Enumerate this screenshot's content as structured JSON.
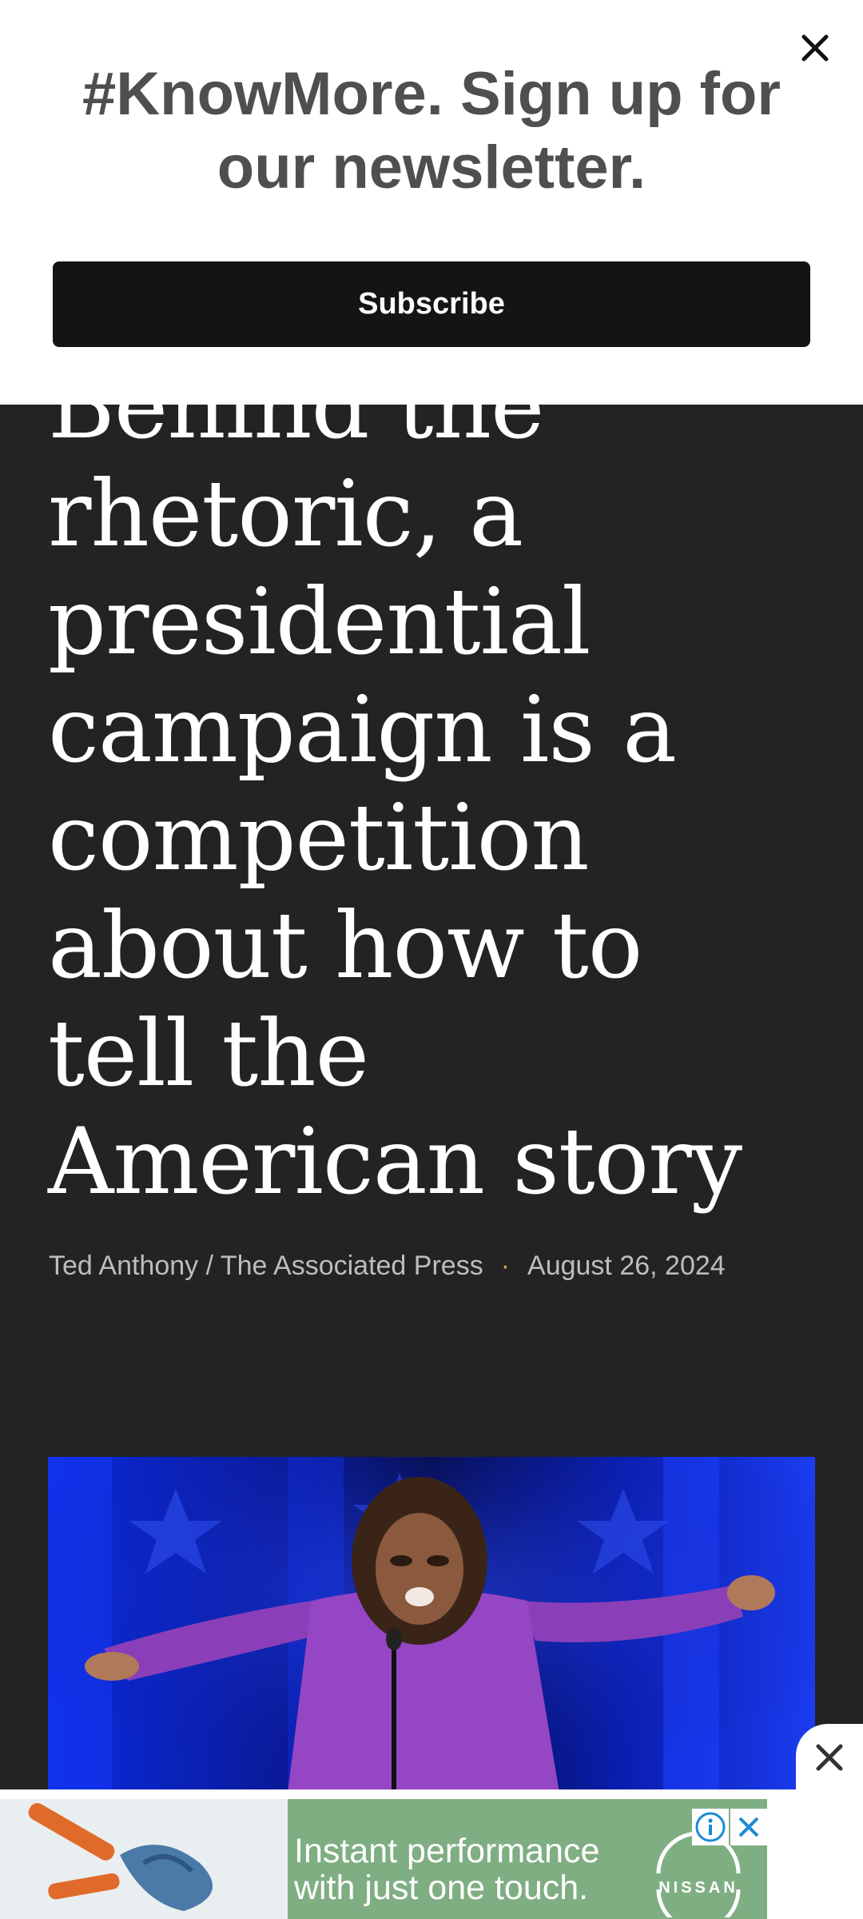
{
  "newsletter": {
    "title": "#KnowMore. Sign up for our newsletter.",
    "subscribe_label": "Subscribe",
    "close_icon": "close-icon"
  },
  "article": {
    "headline": "Behind the rhetoric, a presidential campaign is a competition about how to tell the American story",
    "author": "Ted Anthony / The Associated Press",
    "separator": "·",
    "date": "August 26, 2024"
  },
  "ad": {
    "text": "Instant performance with just one touch.",
    "brand": "NISSAN",
    "info_icon": "info-icon",
    "close_icon": "close-icon",
    "background_color": "#7fae82"
  },
  "colors": {
    "page_background": "#232324",
    "subscribe_button": "#141414",
    "byline_dot": "#d9a23a"
  }
}
